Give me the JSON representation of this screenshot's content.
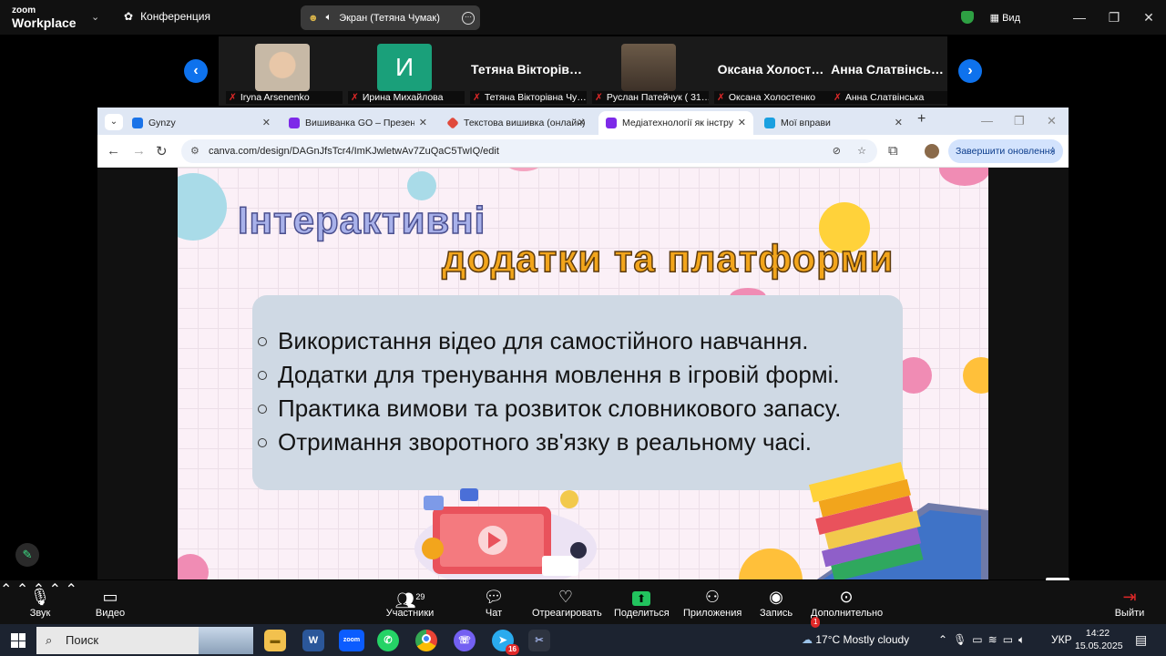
{
  "zoom": {
    "logo_line1": "zoom",
    "logo_line2": "Workplace",
    "meeting_label": "Конференция",
    "screen_share_label": "Экран (Тетяна Чумак)",
    "view_label": "Вид",
    "accent": "#0e72ed",
    "participants": [
      {
        "name": "Iryna Arsenenko",
        "thumb": "photo",
        "color": "#c7b9a6"
      },
      {
        "name": "Ирина Михайлова",
        "thumb": "letter",
        "letter": "И",
        "color": "#1aa07a"
      },
      {
        "name": "Тетяна Вікторівна Чу…",
        "thumb": "text",
        "big": "Тетяна Вікторів…"
      },
      {
        "name": "Руслан Патейчук ( 31…",
        "thumb": "photo",
        "color": "#5a4a3c"
      },
      {
        "name": "Оксана Холостенко",
        "thumb": "text",
        "big": "Оксана Холост…"
      },
      {
        "name": "Анна Слатвінська",
        "thumb": "text",
        "big": "Анна Слатвінсь…"
      }
    ],
    "toolbar": {
      "audio": "Звук",
      "video": "Видео",
      "participants": "Участники",
      "participants_count": "29",
      "chat": "Чат",
      "react": "Отреагировать",
      "share": "Поделиться",
      "apps": "Приложения",
      "record": "Запись",
      "more": "Дополнительно",
      "leave": "Выйти"
    }
  },
  "browser": {
    "tabs": [
      {
        "title": "Gynzy",
        "icon_color": "#1a73e8"
      },
      {
        "title": "Вишиванка GO – Презентаці…",
        "icon_color": "#7d2ae8"
      },
      {
        "title": "Текстова вишивка (онлайн)",
        "icon_color": "#e04a3c"
      },
      {
        "title": "Медіатехнології як інструме…",
        "icon_color": "#7d2ae8",
        "active": true
      },
      {
        "title": "Мої вправи",
        "icon_color": "#1aa0e0"
      }
    ],
    "url": "canva.com/design/DAGnJfsTcr4/ImKJwletwAv7ZuQaC5TwIQ/edit",
    "update_button": "Завершити оновлення"
  },
  "slide": {
    "title_line1": "Інтерактивні",
    "title_line2": "додатки та платформи",
    "bullets": [
      "Використання відео для самостійного навчання.",
      "Додатки для тренування мовлення в ігровій формі.",
      "Практика вимови та розвиток словникового запасу.",
      "Отримання зворотного зв'язку в реальному часі."
    ]
  },
  "taskbar": {
    "search_label": "Поиск",
    "weather": "17°C  Mostly cloudy",
    "lang": "УКР",
    "time": "14:22",
    "date": "15.05.2025",
    "badge_weather": "1",
    "badge_telegram": "16"
  }
}
